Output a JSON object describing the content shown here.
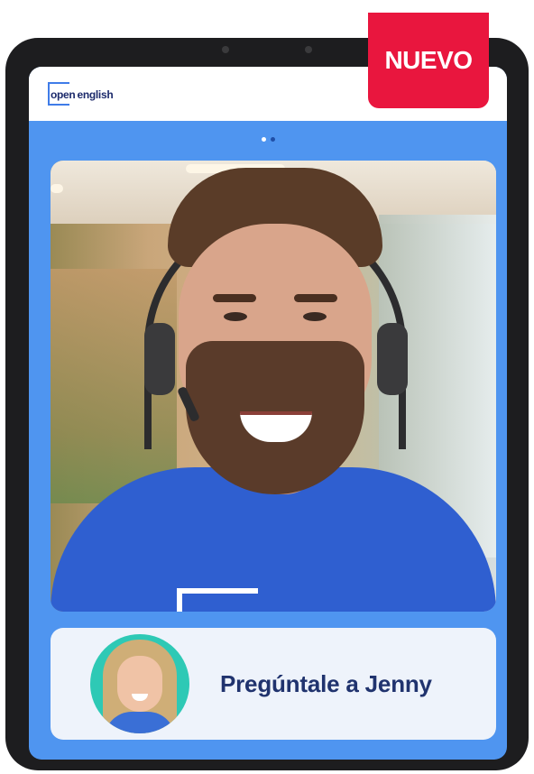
{
  "badge": {
    "label": "NUEVO"
  },
  "header": {
    "logo_part1": "open",
    "logo_part2": "english"
  },
  "carousel": {
    "total_dots": 2,
    "active_index": 0
  },
  "cta": {
    "label": "Pregúntale a Jenny"
  },
  "colors": {
    "screen_bg": "#4f95f0",
    "badge": "#e9163e",
    "cta_text": "#20336e",
    "shirt": "#2f5fd0",
    "avatar_bg": "#2ec9b5"
  }
}
